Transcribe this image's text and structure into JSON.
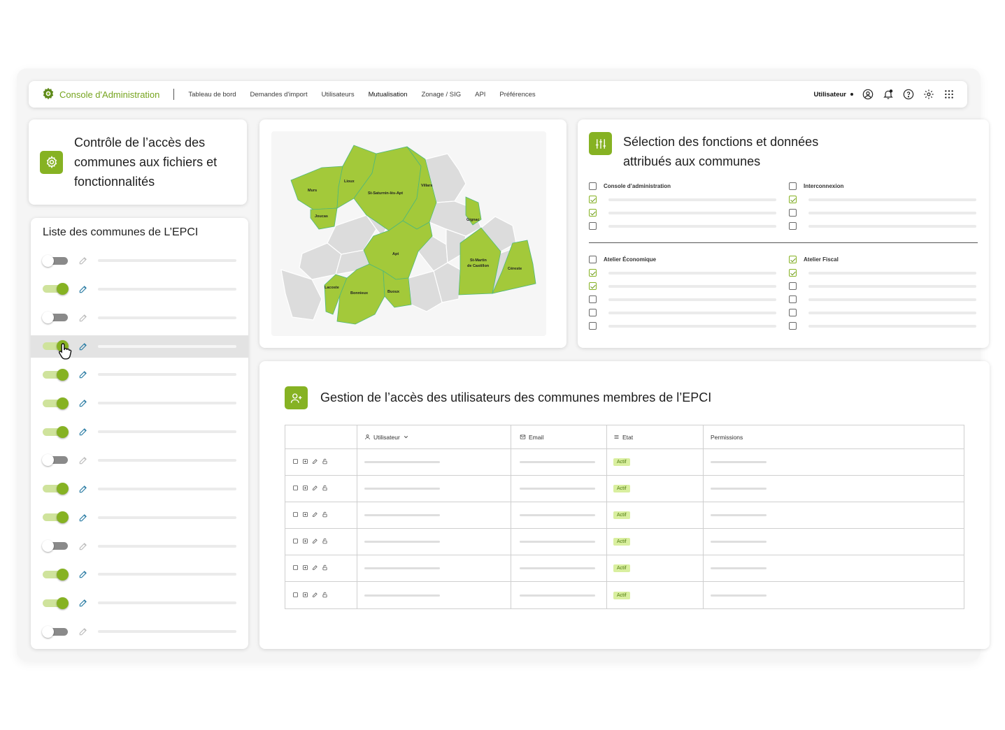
{
  "app": {
    "title": "Console d'Administration",
    "nav": [
      "Tableau de bord",
      "Demandes d'import",
      "Utilisateurs",
      "Mutualisation",
      "Zonage / SIG",
      "API",
      "Préférences"
    ],
    "active_nav": "Mutualisation",
    "user": "Utilisateur",
    "accent": "#86b223"
  },
  "control": {
    "title": "Contrôle de l’accès des communes aux fichiers et fonctionnalités"
  },
  "communes": {
    "title": "Liste des communes de L’EPCI",
    "toggles": [
      false,
      true,
      false,
      true,
      true,
      true,
      true,
      false,
      true,
      true,
      false,
      true,
      true,
      false
    ],
    "highlighted_row": 4
  },
  "map": {
    "labels": [
      "Murs",
      "Lioux",
      "St-Saturnin-lès-Apt",
      "Villars",
      "Joucas",
      "Gignac",
      "Apt",
      "St-Martin",
      "de Castillon",
      "Céreste",
      "Lacoste",
      "Bonnieux",
      "Buoux"
    ]
  },
  "selection": {
    "title": "Sélection des fonctions et données attribués aux communes",
    "groups": [
      {
        "label": "Console d’administration",
        "checked": false,
        "items": [
          true,
          true,
          false
        ]
      },
      {
        "label": "Interconnexion",
        "checked": false,
        "items": [
          true,
          false,
          false
        ]
      },
      {
        "label": "Atelier Économique",
        "checked": false,
        "items": [
          true,
          true,
          false,
          false,
          false
        ]
      },
      {
        "label": "Atelier Fiscal",
        "checked": true,
        "items": [
          true,
          false,
          false,
          false,
          false
        ]
      }
    ]
  },
  "users": {
    "title": "Gestion de l’accès des utilisateurs des communes membres de l’EPCI",
    "columns": {
      "user": "Utilisateur",
      "email": "Email",
      "state": "Etat",
      "permissions": "Permissions"
    },
    "rows": [
      "Actif",
      "Actif",
      "Actif",
      "Actif",
      "Actif",
      "Actif"
    ]
  }
}
